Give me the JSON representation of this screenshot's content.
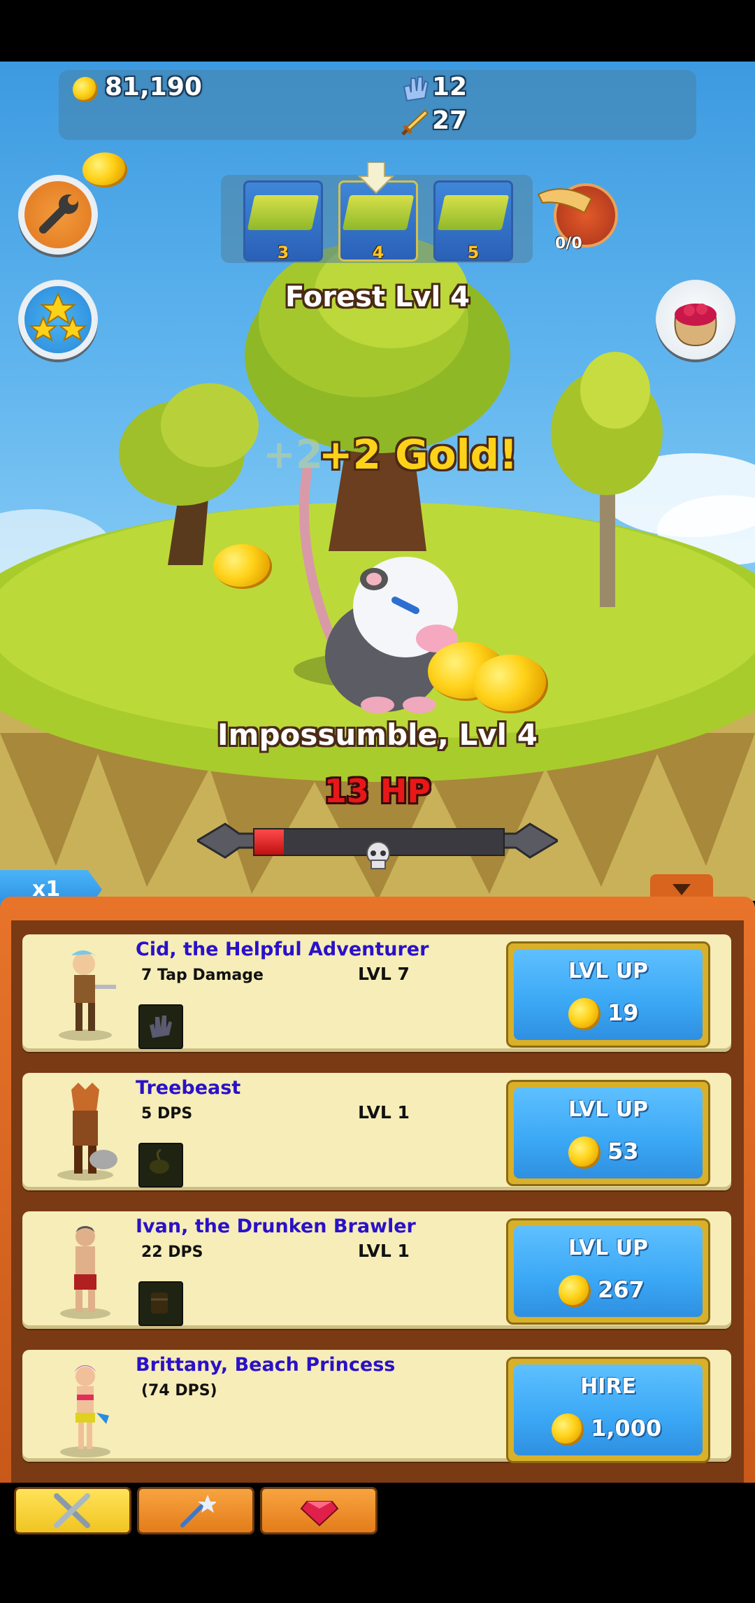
{
  "stats": {
    "gold": "81,190",
    "clicks": "12",
    "damage": "27"
  },
  "zone": {
    "title": "Forest Lvl 4",
    "tiles": [
      "3",
      "4",
      "5"
    ],
    "quest_progress": "0/0"
  },
  "floating_text": {
    "ghost": "+2",
    "main": "+2 Gold!"
  },
  "monster": {
    "name": "Impossumble, Lvl 4",
    "hp": "13 HP",
    "health_fraction": 0.12
  },
  "multiplier": "x1",
  "heroes": [
    {
      "name": "Cid, the Helpful Adventurer",
      "stat": "7 Tap Damage",
      "level": "LVL 7",
      "button": "LVL UP",
      "cost": "19"
    },
    {
      "name": "Treebeast",
      "stat": "5 DPS",
      "level": "LVL 1",
      "button": "LVL UP",
      "cost": "53"
    },
    {
      "name": "Ivan, the Drunken Brawler",
      "stat": "22 DPS",
      "level": "LVL 1",
      "button": "LVL UP",
      "cost": "267"
    },
    {
      "name": "Brittany, Beach Princess",
      "stat": "(74 DPS)",
      "level": "",
      "button": "HIRE",
      "cost": "1,000"
    }
  ],
  "tabs": [
    "heroes-tab",
    "upgrades-tab",
    "gems-tab"
  ],
  "colors": {
    "hero_name": "#2a11c9",
    "button_blue": "#3aa7f5",
    "panel_orange": "#e8742a",
    "hp_red": "#e81818"
  }
}
